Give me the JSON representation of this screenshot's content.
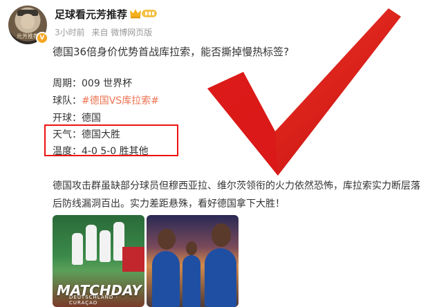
{
  "post": {
    "username": "足球看元芳推荐",
    "level_badge": "V",
    "avatar_text": "元芳推荐",
    "time": "3小时前",
    "source": "来自 微博网页版",
    "headline": "德国36倍身价优势首战库拉索，能否撕掉慢热标签?",
    "details": [
      {
        "label": "周期：",
        "value": "009 世界杯"
      },
      {
        "label": "球队：",
        "value": "#德国VS库拉索#"
      },
      {
        "label": "开球：",
        "value": "德国"
      },
      {
        "label": "天气：",
        "value": "德国大胜"
      },
      {
        "label": "温度：",
        "value": "4-0 5-0 胜其他"
      }
    ],
    "body": "德国攻击群虽缺部分球员但穆西亚拉、维尔茨领衔的火力依然恐怖，库拉索实力断层落后防线漏洞百出。实力差距悬殊，看好德国拿下大胜！",
    "images": [
      {
        "title": "MATCHDAY",
        "subtitle": "DEUTSCHLAND - CURAÇAO"
      },
      {
        "title": ""
      }
    ]
  },
  "colors": {
    "accent": "#eb7350",
    "check_red": "#e11c1c",
    "highlight_box": "#e11111",
    "verified_badge": "#f5a623"
  }
}
